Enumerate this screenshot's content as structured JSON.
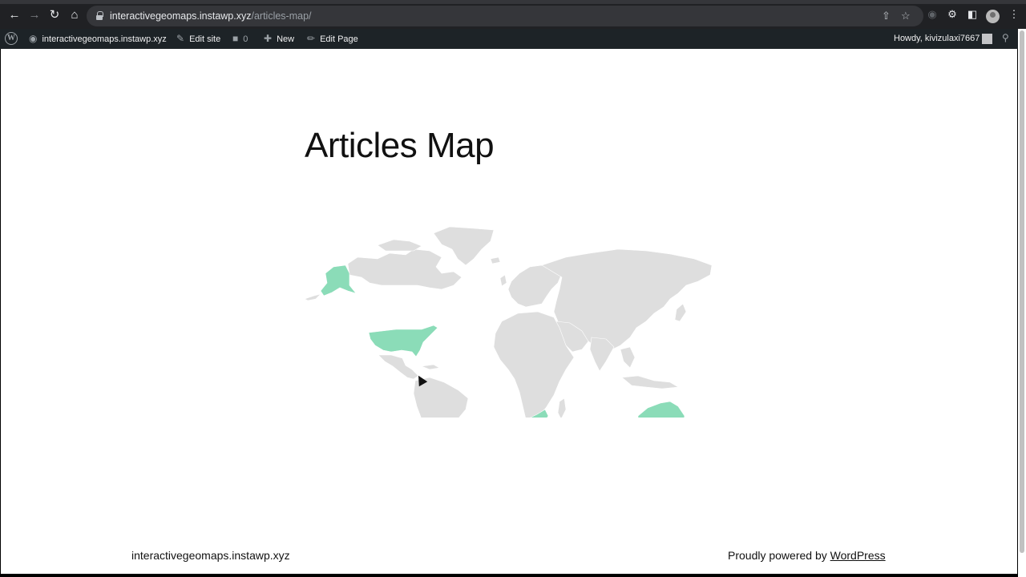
{
  "browser": {
    "url_host": "interactivegeomaps.instawp.xyz",
    "url_path": "/articles-map/"
  },
  "adminbar": {
    "site_name": "interactivegeomaps.instawp.xyz",
    "edit_site": "Edit site",
    "comments_count": "0",
    "new_label": "New",
    "edit_page": "Edit Page",
    "howdy": "Howdy, kivizulaxi7667"
  },
  "page": {
    "title": "Articles Map"
  },
  "map": {
    "highlighted_regions": [
      "Alaska",
      "United States",
      "South Africa",
      "Australia"
    ],
    "highlight_color": "#8bdcb8",
    "base_color": "#dedede"
  },
  "footer": {
    "site_title": "interactivegeomaps.instawp.xyz",
    "credit_prefix": "Proudly powered by",
    "credit_link": "WordPress"
  },
  "colors": {
    "adminbar_bg": "#1d2327",
    "browser_bg": "#202124"
  }
}
